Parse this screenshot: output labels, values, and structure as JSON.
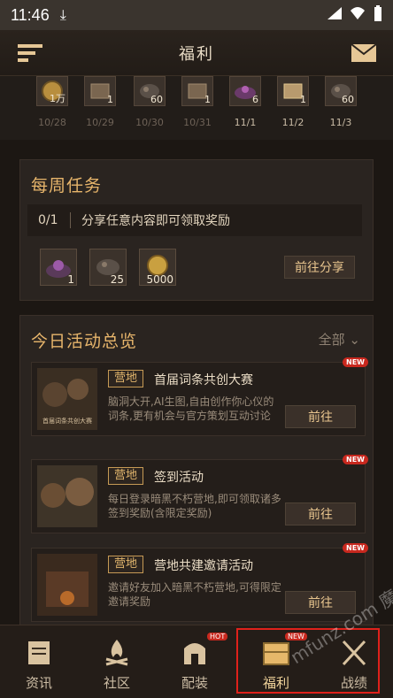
{
  "status_bar": {
    "time": "11:46"
  },
  "header": {
    "title": "福利"
  },
  "signin": {
    "items": [
      {
        "count": "1万",
        "date": "10/28",
        "active": false
      },
      {
        "count": "1",
        "date": "10/29",
        "active": false
      },
      {
        "count": "60",
        "date": "10/30",
        "active": false
      },
      {
        "count": "1",
        "date": "10/31",
        "active": false
      },
      {
        "count": "6",
        "date": "11/1",
        "active": true
      },
      {
        "count": "1",
        "date": "11/2",
        "active": true
      },
      {
        "count": "60",
        "date": "11/3",
        "active": true
      }
    ]
  },
  "weekly": {
    "title": "每周任务",
    "progress": "0/1",
    "task": "分享任意内容即可领取奖励",
    "rewards": [
      "1",
      "25",
      "5000"
    ],
    "button": "前往分享"
  },
  "overview": {
    "title": "今日活动总览",
    "filter": "全部",
    "activities": [
      {
        "tag": "营地",
        "title": "首届词条共创大赛",
        "desc": "脑洞大开,AI生图,自由创作你心仪的词条,更有机会与官方策划互动讨论",
        "button": "前往",
        "badge": "NEW",
        "image_caption": "首届词条共创大赛"
      },
      {
        "tag": "营地",
        "title": "签到活动",
        "desc": "每日登录暗黑不朽营地,即可领取诸多签到奖励(含限定奖励)",
        "button": "前往",
        "badge": "NEW"
      },
      {
        "tag": "营地",
        "title": "营地共建邀请活动",
        "desc": "邀请好友加入暗黑不朽营地,可得限定邀请奖励",
        "button": "前往",
        "badge": "NEW"
      }
    ]
  },
  "tabs": [
    {
      "label": "资讯",
      "icon": "scroll-icon"
    },
    {
      "label": "社区",
      "icon": "campfire-icon"
    },
    {
      "label": "配装",
      "icon": "helmet-icon",
      "badge": "HOT"
    },
    {
      "label": "福利",
      "icon": "chest-icon",
      "badge": "NEW",
      "active": true
    },
    {
      "label": "战绩",
      "icon": "crossed-swords-icon"
    }
  ],
  "watermark": "mfunz.com",
  "watermark_logo": "魔方网",
  "colors": {
    "accent": "#e7b56b",
    "highlight": "#e0211b"
  }
}
